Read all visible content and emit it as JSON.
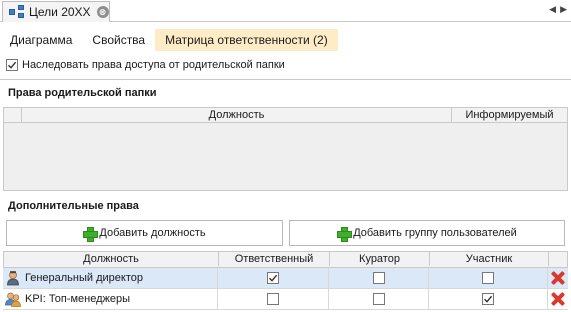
{
  "window": {
    "tab_title": "Цели 20XX",
    "close_glyph": "⊗",
    "nav_prev": "◀",
    "nav_next": "▶"
  },
  "subtabs": [
    {
      "label": "Диаграмма",
      "active": false
    },
    {
      "label": "Свойства",
      "active": false
    },
    {
      "label": "Матрица ответственности (2)",
      "active": true
    }
  ],
  "inherit": {
    "label": "Наследовать права доступа от родительской папки",
    "checked": true
  },
  "parent_rights": {
    "title": "Права родительской папки",
    "columns": [
      "Должность",
      "Информируемый"
    ]
  },
  "additional_rights": {
    "title": "Дополнительные права",
    "add_position_button": "Добавить должность",
    "add_group_button": "Добавить группу пользователей",
    "columns": [
      "Должность",
      "Ответственный",
      "Куратор",
      "Участник"
    ],
    "rows": [
      {
        "name": "Генеральный директор",
        "icon": "user-icon",
        "responsible": true,
        "curator": false,
        "participant": false,
        "selected": true
      },
      {
        "name": "KPI: Топ-менеджеры",
        "icon": "user-group-icon",
        "responsible": false,
        "curator": false,
        "participant": true,
        "selected": false
      }
    ]
  },
  "colors": {
    "active_subtab": "#fdecc6",
    "selected_row": "#dbe8f7",
    "add_green": "#3fae2a",
    "delete_red": "#d93a2b"
  }
}
